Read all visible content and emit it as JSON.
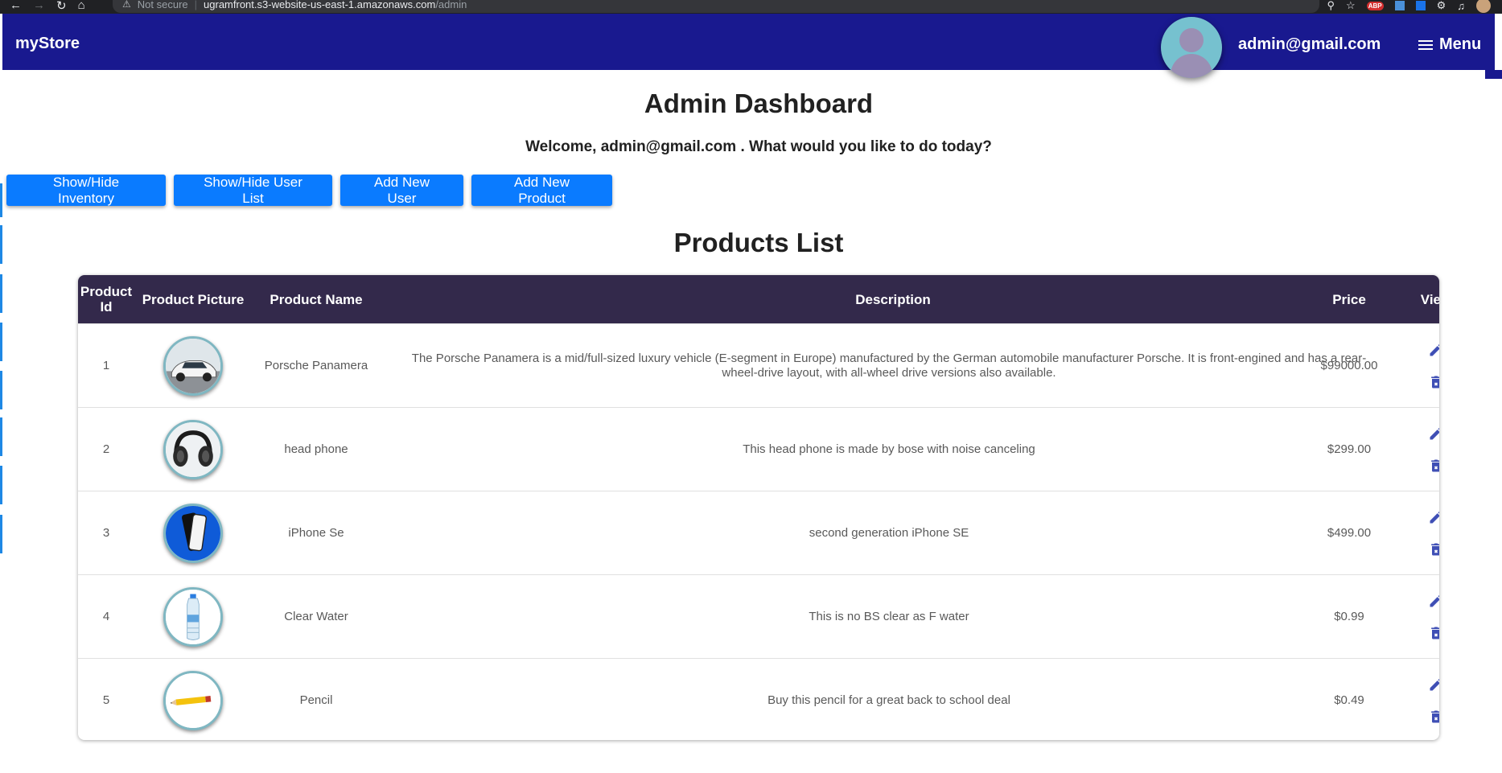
{
  "browser": {
    "security_label": "Not secure",
    "url_host": "ugramfront.s3-website-us-east-1.amazonaws.com",
    "url_path": "/admin",
    "extension_badge": "ABP"
  },
  "header": {
    "brand": "myStore",
    "user_email": "admin@gmail.com",
    "menu_label": "Menu"
  },
  "page": {
    "title": "Admin Dashboard",
    "welcome": "Welcome, admin@gmail.com . What would you like to do today?"
  },
  "actions": {
    "toggle_inventory": "Show/Hide Inventory",
    "toggle_users": "Show/Hide User List",
    "add_user": "Add New User",
    "add_product": "Add New Product"
  },
  "products": {
    "title": "Products List",
    "columns": {
      "id": "Product Id",
      "picture": "Product Picture",
      "name": "Product Name",
      "description": "Description",
      "price": "Price",
      "view": "View"
    },
    "rows": [
      {
        "id": "1",
        "picture_icon": "car-icon",
        "name": "Porsche Panamera",
        "description": "The Porsche Panamera is a mid/full-sized luxury vehicle (E-segment in Europe) manufactured by the German automobile manufacturer Porsche. It is front-engined and has a rear-wheel-drive layout, with all-wheel drive versions also available.",
        "price": "$99000.00"
      },
      {
        "id": "2",
        "picture_icon": "headphones-icon",
        "name": "head phone",
        "description": "This head phone is made by bose with noise canceling",
        "price": "$299.00"
      },
      {
        "id": "3",
        "picture_icon": "phone-icon",
        "name": "iPhone Se",
        "description": "second generation iPhone SE",
        "price": "$499.00"
      },
      {
        "id": "4",
        "picture_icon": "water-bottle-icon",
        "name": "Clear Water",
        "description": "This is no BS clear as F water",
        "price": "$0.99"
      },
      {
        "id": "5",
        "picture_icon": "pencil-icon",
        "name": "Pencil",
        "description": "Buy this pencil for a great back to school deal",
        "price": "$0.49"
      }
    ]
  },
  "colors": {
    "appbar": "#19198f",
    "button": "#0a7bff",
    "table_header": "#33294b",
    "action_icon": "#3f4fb5"
  }
}
